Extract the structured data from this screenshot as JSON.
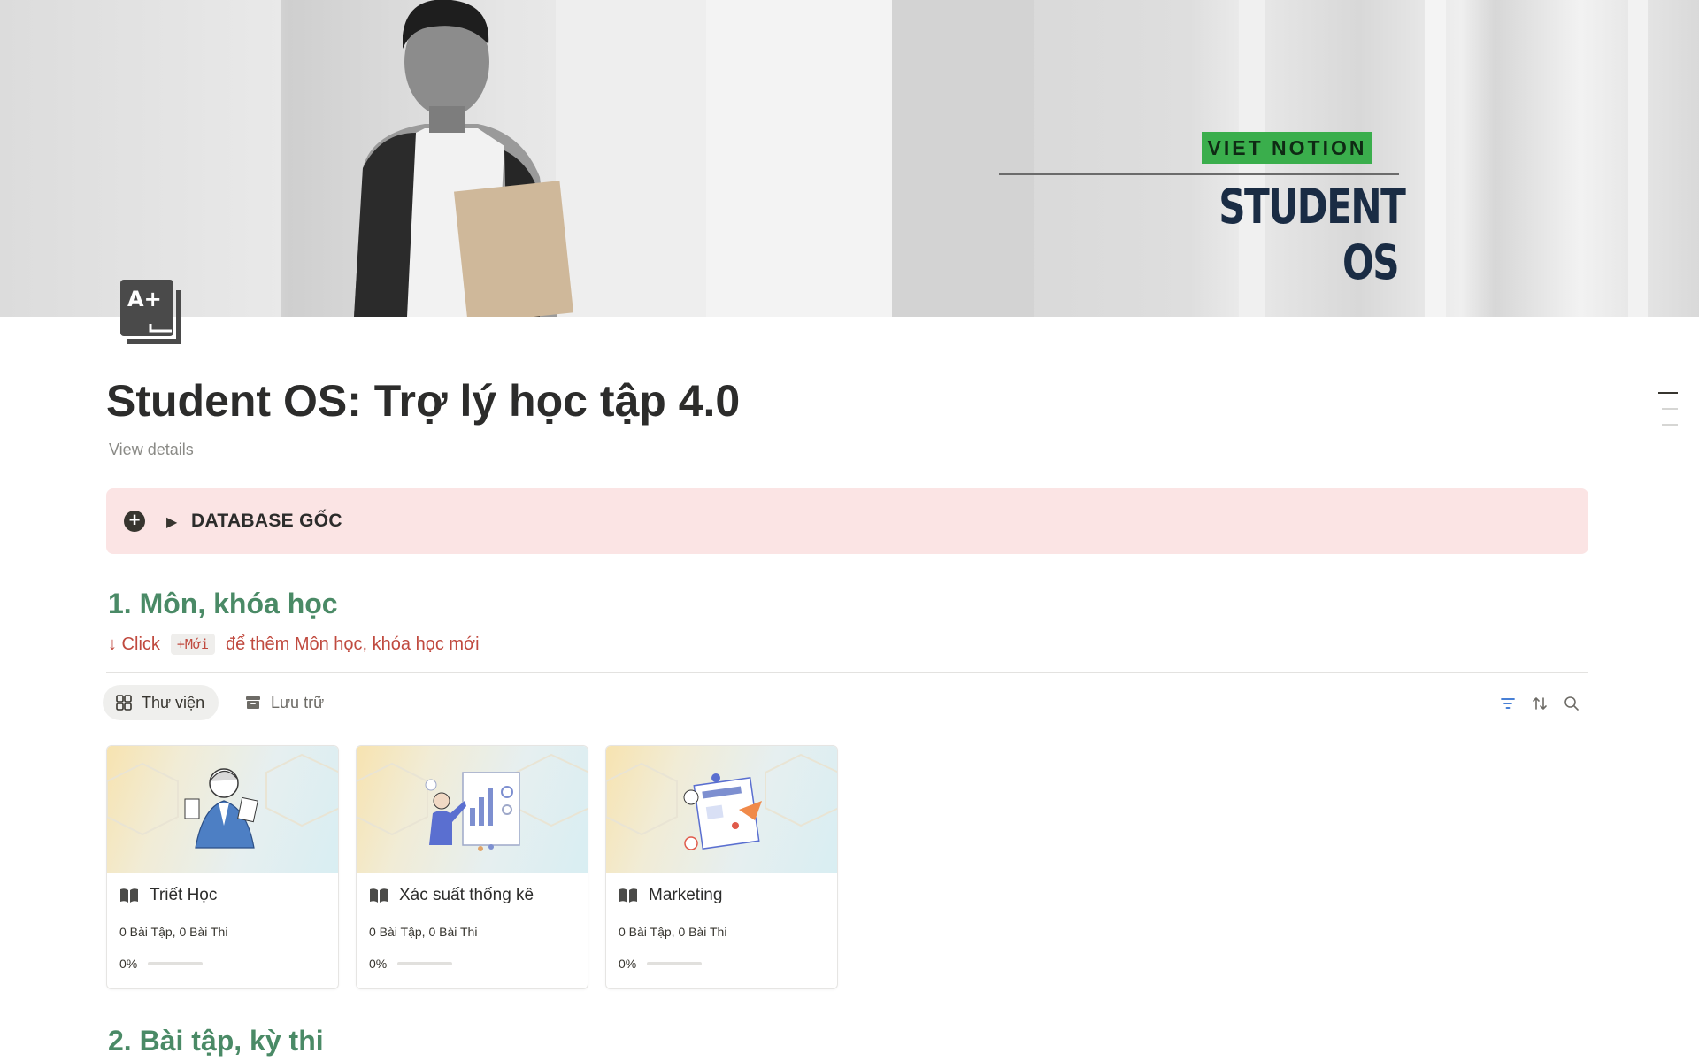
{
  "cover": {
    "tag_text": "VIET NOTION",
    "brand_text": "STUDENT OS",
    "tag_color": "#3aae4c"
  },
  "page": {
    "icon": "grade-a-plus-icon",
    "title": "Student OS: Trợ lý học tập 4.0",
    "view_details": "View details"
  },
  "callout": {
    "icon": "plus-circle-icon",
    "toggle_icon": "▶",
    "label": "DATABASE GỐC",
    "background": "#fbe4e4"
  },
  "section1": {
    "heading": "1. Môn, khóa học",
    "hint_prefix": "↓ Click",
    "hint_code": "+Mới",
    "hint_suffix": "để thêm Môn học, khóa học mới"
  },
  "views": {
    "tabs": [
      {
        "label": "Thư viện",
        "icon": "gallery-grid-icon",
        "active": true
      },
      {
        "label": "Lưu trữ",
        "icon": "archive-icon",
        "active": false
      }
    ],
    "tools": [
      "filter-icon",
      "sort-icon",
      "search-icon"
    ]
  },
  "cards": [
    {
      "title": "Triết Học",
      "meta": "0 Bài Tập, 0 Bài Thi",
      "progress_label": "0%",
      "progress": 0
    },
    {
      "title": "Xác suất thống kê",
      "meta": "0 Bài Tập, 0 Bài Thi",
      "progress_label": "0%",
      "progress": 0
    },
    {
      "title": "Marketing",
      "meta": "0 Bài Tập, 0 Bài Thi",
      "progress_label": "0%",
      "progress": 0
    }
  ],
  "section2": {
    "heading": "2. Bài tập, kỳ thi"
  },
  "colors": {
    "heading_green": "#4a8a66",
    "hint_red": "#c04a3f"
  }
}
